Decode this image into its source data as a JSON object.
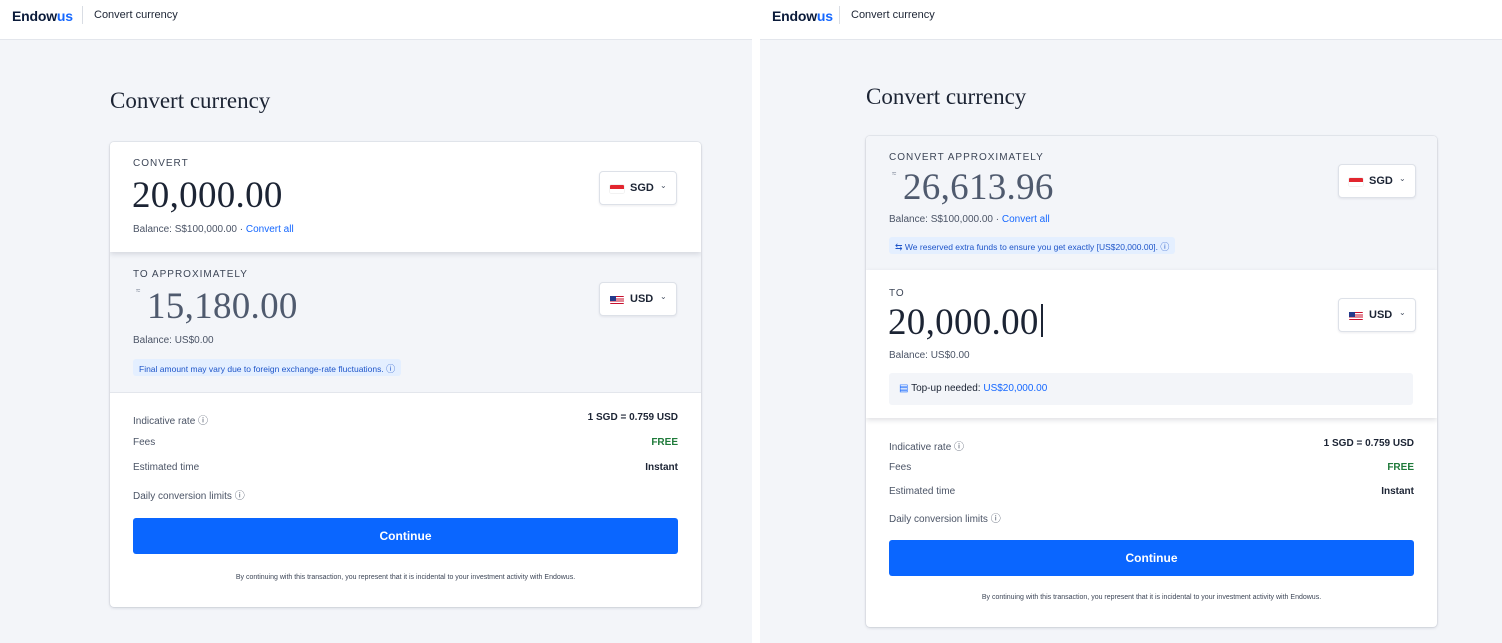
{
  "brand": {
    "logo_main": "Endow",
    "logo_accent": "us",
    "accent_color": "#1668ff"
  },
  "left": {
    "topbar_title": "Convert currency",
    "page_title": "Convert currency",
    "from": {
      "label": "CONVERT",
      "amount": "20,000.00",
      "balance_prefix": "Balance: S$100,000.00 · ",
      "convert_all": "Convert all",
      "currency": {
        "code": "SGD",
        "flag_icon": "sg-flag-icon"
      }
    },
    "to": {
      "label": "TO APPROXIMATELY",
      "approx_symbol": "≈",
      "amount": "15,180.00",
      "balance": "Balance: US$0.00",
      "notice": "Final amount may vary due to foreign exchange-rate fluctuations.",
      "notice_icon": "ⓘ",
      "currency": {
        "code": "USD",
        "flag_icon": "us-flag-icon"
      }
    },
    "details": {
      "indicative_rate_label": "Indicative rate",
      "indicative_rate_value": "1 SGD = 0.759 USD",
      "fees_label": "Fees",
      "fees_value": "FREE",
      "time_label": "Estimated time",
      "time_value": "Instant",
      "limits_label": "Daily conversion limits",
      "info_icon": "ⓘ"
    },
    "continue_label": "Continue",
    "disclaimer": "By continuing with this transaction, you represent that it is incidental to your investment activity with Endowus."
  },
  "right": {
    "topbar_title": "Convert currency",
    "page_title": "Convert currency",
    "from": {
      "label": "CONVERT APPROXIMATELY",
      "approx_symbol": "≈",
      "amount": "26,613.96",
      "balance_prefix": "Balance: S$100,000.00 · ",
      "convert_all": "Convert all",
      "notice": "We reserved extra funds to ensure you get exactly [US$20,000.00].",
      "notice_lead_icon": "⇆",
      "notice_icon": "ⓘ",
      "currency": {
        "code": "SGD",
        "flag_icon": "sg-flag-icon"
      }
    },
    "to": {
      "label": "TO",
      "amount": "20,000.00",
      "balance": "Balance: US$0.00",
      "topup_icon": "▤",
      "topup_label": "Top-up needed: ",
      "topup_amount": "US$20,000.00",
      "currency": {
        "code": "USD",
        "flag_icon": "us-flag-icon"
      }
    },
    "details": {
      "indicative_rate_label": "Indicative rate",
      "indicative_rate_value": "1 SGD = 0.759 USD",
      "fees_label": "Fees",
      "fees_value": "FREE",
      "time_label": "Estimated time",
      "time_value": "Instant",
      "limits_label": "Daily conversion limits",
      "info_icon": "ⓘ"
    },
    "continue_label": "Continue",
    "disclaimer": "By continuing with this transaction, you represent that it is incidental to your investment activity with Endowus."
  },
  "chevron_icon": "⌄",
  "colors": {
    "primary_button": "#0a66ff",
    "free_text": "#1f7a3a",
    "page_bg": "#f3f5f9"
  }
}
